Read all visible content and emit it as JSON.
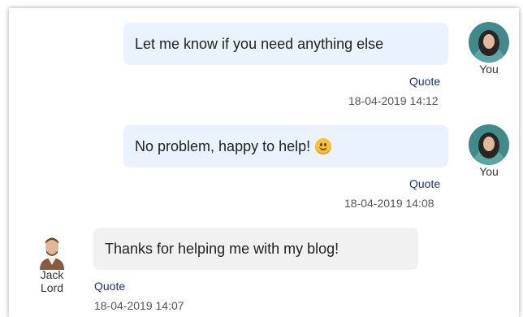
{
  "messages": [
    {
      "text": "Let me know if you need anything else",
      "quote_label": "Quote",
      "timestamp": "18-04-2019 14:12",
      "sender": "You"
    },
    {
      "text": "No problem, happy to help!",
      "emoji": "smiling-face-emoji",
      "quote_label": "Quote",
      "timestamp": "18-04-2019 14:08",
      "sender": "You"
    },
    {
      "text": "Thanks for helping me with my blog!",
      "quote_label": "Quote",
      "timestamp": "18-04-2019 14:07",
      "sender_line1": "Jack",
      "sender_line2": "Lord"
    }
  ],
  "colors": {
    "my_bubble": "#eaf3fd",
    "their_bubble": "#f1f1f1",
    "quote_link": "#1f2f7a",
    "my_avatar_bg": "#3f8a8a"
  }
}
